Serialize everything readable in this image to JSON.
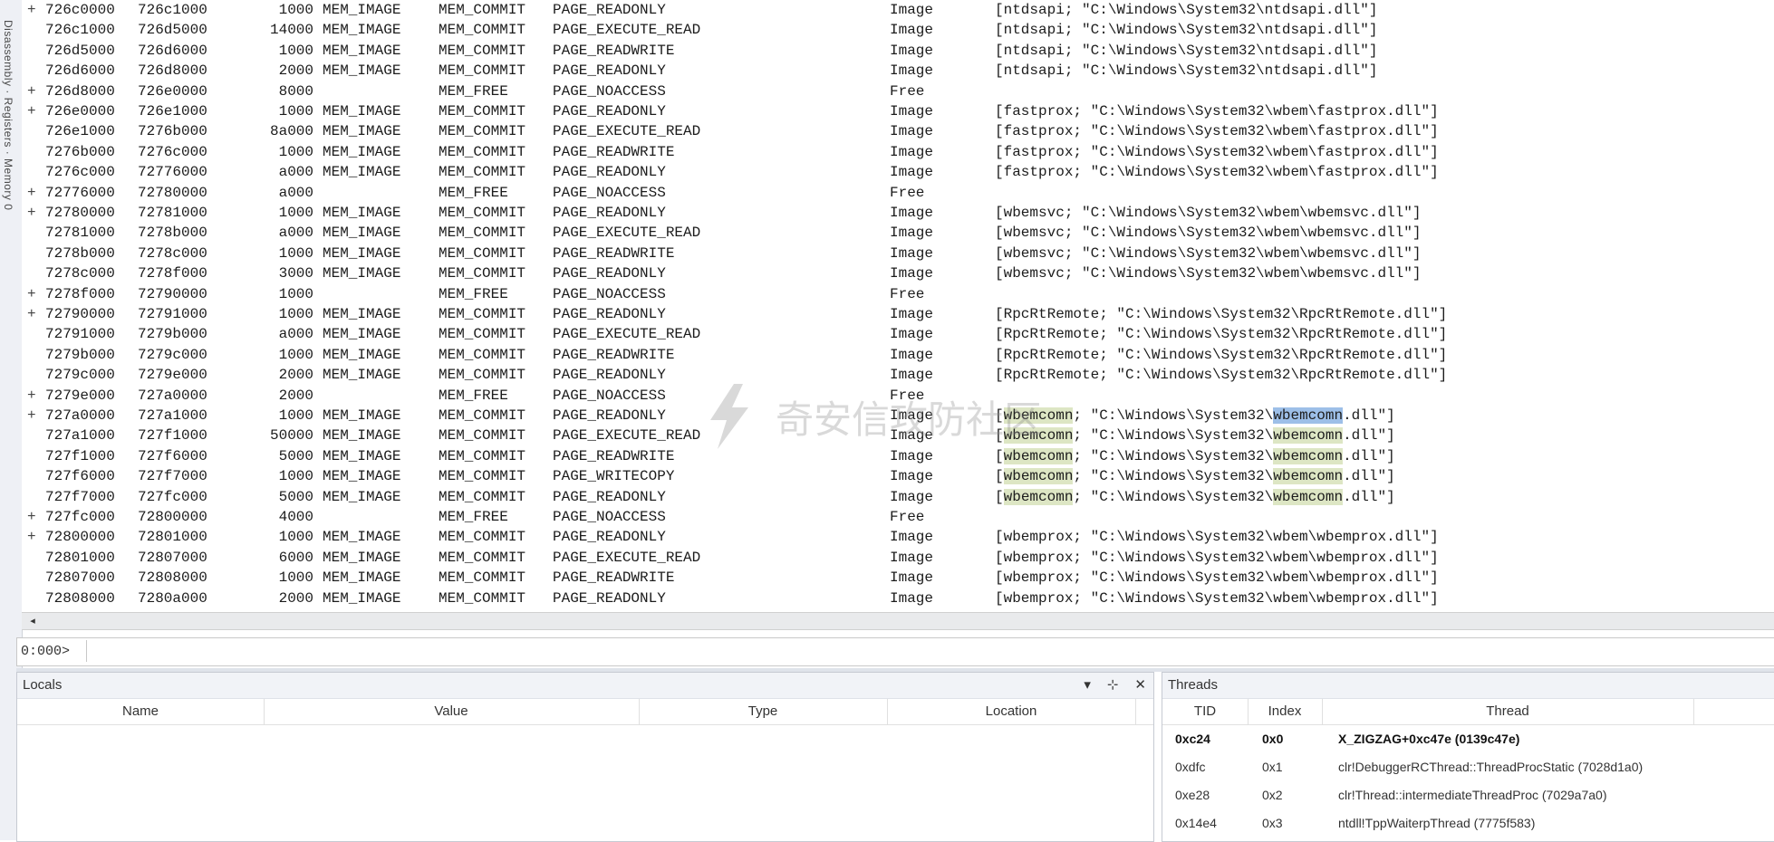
{
  "left_panel": {
    "label": "Disassembly · Registers · Memory 0"
  },
  "memory_rows": [
    {
      "mark": "+",
      "base": "726c0000",
      "end": "726c1000",
      "size": "1000",
      "type": "MEM_IMAGE",
      "state": "MEM_COMMIT",
      "protect": "PAGE_READONLY",
      "usage": "Image",
      "info": "[ntdsapi; \"C:\\Windows\\System32\\ntdsapi.dll\"]"
    },
    {
      "mark": "",
      "base": "726c1000",
      "end": "726d5000",
      "size": "14000",
      "type": "MEM_IMAGE",
      "state": "MEM_COMMIT",
      "protect": "PAGE_EXECUTE_READ",
      "usage": "Image",
      "info": "[ntdsapi; \"C:\\Windows\\System32\\ntdsapi.dll\"]"
    },
    {
      "mark": "",
      "base": "726d5000",
      "end": "726d6000",
      "size": "1000",
      "type": "MEM_IMAGE",
      "state": "MEM_COMMIT",
      "protect": "PAGE_READWRITE",
      "usage": "Image",
      "info": "[ntdsapi; \"C:\\Windows\\System32\\ntdsapi.dll\"]"
    },
    {
      "mark": "",
      "base": "726d6000",
      "end": "726d8000",
      "size": "2000",
      "type": "MEM_IMAGE",
      "state": "MEM_COMMIT",
      "protect": "PAGE_READONLY",
      "usage": "Image",
      "info": "[ntdsapi; \"C:\\Windows\\System32\\ntdsapi.dll\"]"
    },
    {
      "mark": "+",
      "base": "726d8000",
      "end": "726e0000",
      "size": "8000",
      "type": "",
      "state": "MEM_FREE",
      "protect": "PAGE_NOACCESS",
      "usage": "Free",
      "info": ""
    },
    {
      "mark": "+",
      "base": "726e0000",
      "end": "726e1000",
      "size": "1000",
      "type": "MEM_IMAGE",
      "state": "MEM_COMMIT",
      "protect": "PAGE_READONLY",
      "usage": "Image",
      "info": "[fastprox; \"C:\\Windows\\System32\\wbem\\fastprox.dll\"]"
    },
    {
      "mark": "",
      "base": "726e1000",
      "end": "7276b000",
      "size": "8a000",
      "type": "MEM_IMAGE",
      "state": "MEM_COMMIT",
      "protect": "PAGE_EXECUTE_READ",
      "usage": "Image",
      "info": "[fastprox; \"C:\\Windows\\System32\\wbem\\fastprox.dll\"]"
    },
    {
      "mark": "",
      "base": "7276b000",
      "end": "7276c000",
      "size": "1000",
      "type": "MEM_IMAGE",
      "state": "MEM_COMMIT",
      "protect": "PAGE_READWRITE",
      "usage": "Image",
      "info": "[fastprox; \"C:\\Windows\\System32\\wbem\\fastprox.dll\"]"
    },
    {
      "mark": "",
      "base": "7276c000",
      "end": "72776000",
      "size": "a000",
      "type": "MEM_IMAGE",
      "state": "MEM_COMMIT",
      "protect": "PAGE_READONLY",
      "usage": "Image",
      "info": "[fastprox; \"C:\\Windows\\System32\\wbem\\fastprox.dll\"]"
    },
    {
      "mark": "+",
      "base": "72776000",
      "end": "72780000",
      "size": "a000",
      "type": "",
      "state": "MEM_FREE",
      "protect": "PAGE_NOACCESS",
      "usage": "Free",
      "info": ""
    },
    {
      "mark": "+",
      "base": "72780000",
      "end": "72781000",
      "size": "1000",
      "type": "MEM_IMAGE",
      "state": "MEM_COMMIT",
      "protect": "PAGE_READONLY",
      "usage": "Image",
      "info": "[wbemsvc; \"C:\\Windows\\System32\\wbem\\wbemsvc.dll\"]"
    },
    {
      "mark": "",
      "base": "72781000",
      "end": "7278b000",
      "size": "a000",
      "type": "MEM_IMAGE",
      "state": "MEM_COMMIT",
      "protect": "PAGE_EXECUTE_READ",
      "usage": "Image",
      "info": "[wbemsvc; \"C:\\Windows\\System32\\wbem\\wbemsvc.dll\"]"
    },
    {
      "mark": "",
      "base": "7278b000",
      "end": "7278c000",
      "size": "1000",
      "type": "MEM_IMAGE",
      "state": "MEM_COMMIT",
      "protect": "PAGE_READWRITE",
      "usage": "Image",
      "info": "[wbemsvc; \"C:\\Windows\\System32\\wbem\\wbemsvc.dll\"]"
    },
    {
      "mark": "",
      "base": "7278c000",
      "end": "7278f000",
      "size": "3000",
      "type": "MEM_IMAGE",
      "state": "MEM_COMMIT",
      "protect": "PAGE_READONLY",
      "usage": "Image",
      "info": "[wbemsvc; \"C:\\Windows\\System32\\wbem\\wbemsvc.dll\"]"
    },
    {
      "mark": "+",
      "base": "7278f000",
      "end": "72790000",
      "size": "1000",
      "type": "",
      "state": "MEM_FREE",
      "protect": "PAGE_NOACCESS",
      "usage": "Free",
      "info": ""
    },
    {
      "mark": "+",
      "base": "72790000",
      "end": "72791000",
      "size": "1000",
      "type": "MEM_IMAGE",
      "state": "MEM_COMMIT",
      "protect": "PAGE_READONLY",
      "usage": "Image",
      "info": "[RpcRtRemote; \"C:\\Windows\\System32\\RpcRtRemote.dll\"]"
    },
    {
      "mark": "",
      "base": "72791000",
      "end": "7279b000",
      "size": "a000",
      "type": "MEM_IMAGE",
      "state": "MEM_COMMIT",
      "protect": "PAGE_EXECUTE_READ",
      "usage": "Image",
      "info": "[RpcRtRemote; \"C:\\Windows\\System32\\RpcRtRemote.dll\"]"
    },
    {
      "mark": "",
      "base": "7279b000",
      "end": "7279c000",
      "size": "1000",
      "type": "MEM_IMAGE",
      "state": "MEM_COMMIT",
      "protect": "PAGE_READWRITE",
      "usage": "Image",
      "info": "[RpcRtRemote; \"C:\\Windows\\System32\\RpcRtRemote.dll\"]"
    },
    {
      "mark": "",
      "base": "7279c000",
      "end": "7279e000",
      "size": "2000",
      "type": "MEM_IMAGE",
      "state": "MEM_COMMIT",
      "protect": "PAGE_READONLY",
      "usage": "Image",
      "info": "[RpcRtRemote; \"C:\\Windows\\System32\\RpcRtRemote.dll\"]"
    },
    {
      "mark": "+",
      "base": "7279e000",
      "end": "727a0000",
      "size": "2000",
      "type": "",
      "state": "MEM_FREE",
      "protect": "PAGE_NOACCESS",
      "usage": "Free",
      "info": ""
    },
    {
      "mark": "+",
      "base": "727a0000",
      "end": "727a1000",
      "size": "1000",
      "type": "MEM_IMAGE",
      "state": "MEM_COMMIT",
      "protect": "PAGE_READONLY",
      "usage": "Image",
      "info": "[wbemcomn; \"C:\\Windows\\System32\\wbemcomn.dll\"]"
    },
    {
      "mark": "",
      "base": "727a1000",
      "end": "727f1000",
      "size": "50000",
      "type": "MEM_IMAGE",
      "state": "MEM_COMMIT",
      "protect": "PAGE_EXECUTE_READ",
      "usage": "Image",
      "info": "[wbemcomn; \"C:\\Windows\\System32\\wbemcomn.dll\"]"
    },
    {
      "mark": "",
      "base": "727f1000",
      "end": "727f6000",
      "size": "5000",
      "type": "MEM_IMAGE",
      "state": "MEM_COMMIT",
      "protect": "PAGE_READWRITE",
      "usage": "Image",
      "info": "[wbemcomn; \"C:\\Windows\\System32\\wbemcomn.dll\"]"
    },
    {
      "mark": "",
      "base": "727f6000",
      "end": "727f7000",
      "size": "1000",
      "type": "MEM_IMAGE",
      "state": "MEM_COMMIT",
      "protect": "PAGE_WRITECOPY",
      "usage": "Image",
      "info": "[wbemcomn; \"C:\\Windows\\System32\\wbemcomn.dll\"]"
    },
    {
      "mark": "",
      "base": "727f7000",
      "end": "727fc000",
      "size": "5000",
      "type": "MEM_IMAGE",
      "state": "MEM_COMMIT",
      "protect": "PAGE_READONLY",
      "usage": "Image",
      "info": "[wbemcomn; \"C:\\Windows\\System32\\wbemcomn.dll\"]"
    },
    {
      "mark": "+",
      "base": "727fc000",
      "end": "72800000",
      "size": "4000",
      "type": "",
      "state": "MEM_FREE",
      "protect": "PAGE_NOACCESS",
      "usage": "Free",
      "info": ""
    },
    {
      "mark": "+",
      "base": "72800000",
      "end": "72801000",
      "size": "1000",
      "type": "MEM_IMAGE",
      "state": "MEM_COMMIT",
      "protect": "PAGE_READONLY",
      "usage": "Image",
      "info": "[wbemprox; \"C:\\Windows\\System32\\wbem\\wbemprox.dll\"]"
    },
    {
      "mark": "",
      "base": "72801000",
      "end": "72807000",
      "size": "6000",
      "type": "MEM_IMAGE",
      "state": "MEM_COMMIT",
      "protect": "PAGE_EXECUTE_READ",
      "usage": "Image",
      "info": "[wbemprox; \"C:\\Windows\\System32\\wbem\\wbemprox.dll\"]"
    },
    {
      "mark": "",
      "base": "72807000",
      "end": "72808000",
      "size": "1000",
      "type": "MEM_IMAGE",
      "state": "MEM_COMMIT",
      "protect": "PAGE_READWRITE",
      "usage": "Image",
      "info": "[wbemprox; \"C:\\Windows\\System32\\wbem\\wbemprox.dll\"]"
    },
    {
      "mark": "",
      "base": "72808000",
      "end": "7280a000",
      "size": "2000",
      "type": "MEM_IMAGE",
      "state": "MEM_COMMIT",
      "protect": "PAGE_READONLY",
      "usage": "Image",
      "info": "[wbemprox; \"C:\\Windows\\System32\\wbem\\wbemprox.dll\"]"
    }
  ],
  "highlight": {
    "term": "wbemcomn",
    "bg": "#dde6c4",
    "selected_bg": "#9dbfe8"
  },
  "watermark": {
    "text": "奇安信攻防社区"
  },
  "scrollbar": {
    "left_arrow": "◂"
  },
  "command": {
    "prompt": "0:000>",
    "value": ""
  },
  "locals": {
    "title": "Locals",
    "columns": [
      "Name",
      "Value",
      "Type",
      "Location"
    ],
    "rows": []
  },
  "threads": {
    "title": "Threads",
    "columns": [
      "TID",
      "Index",
      "Thread"
    ],
    "rows": [
      {
        "tid": "0xc24",
        "index": "0x0",
        "thread": "X_ZIGZAG+0xc47e (0139c47e)",
        "active": true
      },
      {
        "tid": "0xdfc",
        "index": "0x1",
        "thread": "clr!DebuggerRCThread::ThreadProcStatic (7028d1a0)",
        "active": false
      },
      {
        "tid": "0xe28",
        "index": "0x2",
        "thread": "clr!Thread::intermediateThreadProc (7029a7a0)",
        "active": false
      },
      {
        "tid": "0x14e4",
        "index": "0x3",
        "thread": "ntdll!TppWaiterpThread (7775f583)",
        "active": false
      }
    ]
  },
  "pane_buttons": {
    "dropdown": "▾",
    "pin": "⊹",
    "close": "✕"
  },
  "colors": {
    "pane_header_bg": "#f1f3f7",
    "border": "#c6cad2"
  }
}
